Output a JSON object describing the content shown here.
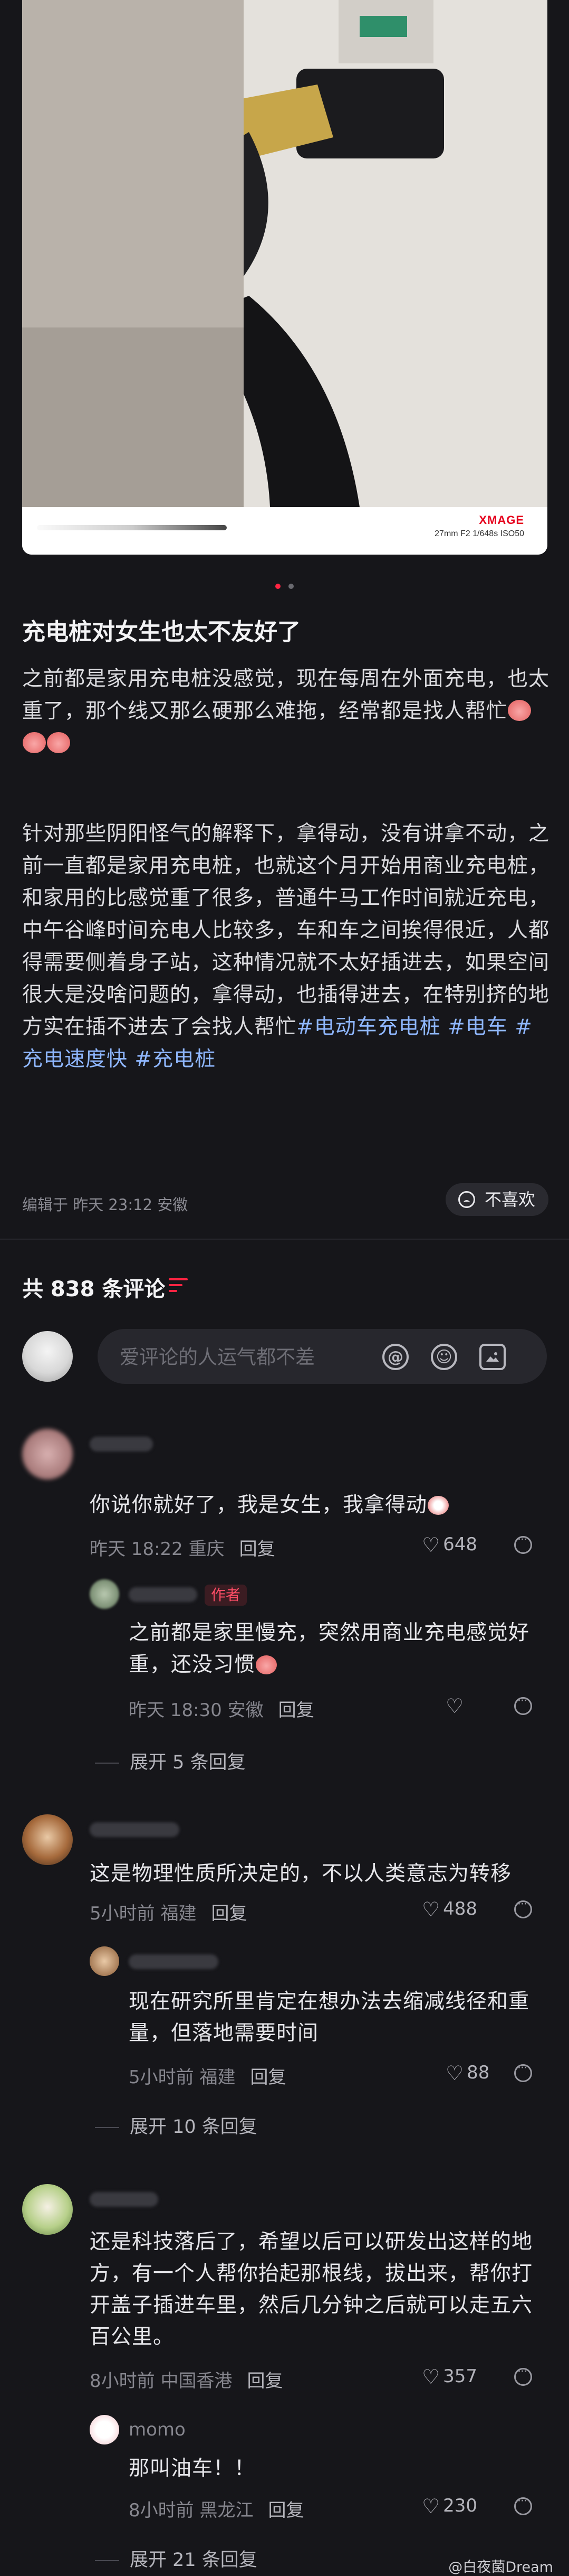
{
  "photo": {
    "brand": "XMAGE",
    "exif": "27mm  F2  1/648s  ISO50"
  },
  "post": {
    "title": "充电桩对女生也太不友好了",
    "para1": "之前都是家用充电桩没感觉，现在每周在外面充电，也太重了，那个线又那么硬那么难拖，经常都是找人帮忙",
    "para2": "针对那些阴阳怪气的解释下，拿得动，没有讲拿不动，之前一直都是家用充电桩，也就这个月开始用商业充电桩，和家用的比感觉重了很多，普通牛马工作时间就近充电，中午谷峰时间充电人比较多，车和车之间挨得很近，人都得需要侧着身子站，这种情况就不太好插进去，如果空间很大是没啥问题的，拿得动，也插得进去，在特别挤的地方实在插不进去了会找人帮忙",
    "tags": [
      "#电动车充电桩",
      "#电车",
      "#充电速度快",
      "#充电桩"
    ],
    "meta": "编辑于 昨天 23:12 安徽",
    "dislike_label": "不喜欢"
  },
  "comments_header": {
    "count_label": "共 838 条评论"
  },
  "comment_input": {
    "placeholder": "爱评论的人运气都不差"
  },
  "comments": [
    {
      "text": "你说你就好了，我是女生，我拿得动",
      "time": "昨天 18:22 重庆",
      "reply": "回复",
      "likes": "648",
      "replies": [
        {
          "tag": "作者",
          "text": "之前都是家里慢充，突然用商业充电感觉好重，还没习惯",
          "time": "昨天 18:30 安徽",
          "reply": "回复"
        }
      ],
      "expand": "展开 5 条回复"
    },
    {
      "text": "这是物理性质所决定的，不以人类意志为转移",
      "time": "5小时前 福建",
      "reply": "回复",
      "likes": "488",
      "replies": [
        {
          "text": "现在研究所里肯定在想办法去缩减线径和重量，但落地需要时间",
          "time": "5小时前 福建",
          "reply": "回复",
          "likes": "88"
        }
      ],
      "expand": "展开 10 条回复"
    },
    {
      "text": "还是科技落后了，希望以后可以研发出这样的地方，有一个人帮你抬起那根线，拔出来，帮你打开盖子插进车里，然后几分钟之后就可以走五六百公里。",
      "time": "8小时前 中国香港",
      "reply": "回复",
      "likes": "357",
      "replies": [
        {
          "name": "momo",
          "text": "那叫油车！！",
          "time": "8小时前 黑龙江",
          "reply": "回复",
          "likes": "230"
        }
      ],
      "expand": "展开 21 条回复"
    }
  ],
  "watermark": "@白夜菌Dream"
}
